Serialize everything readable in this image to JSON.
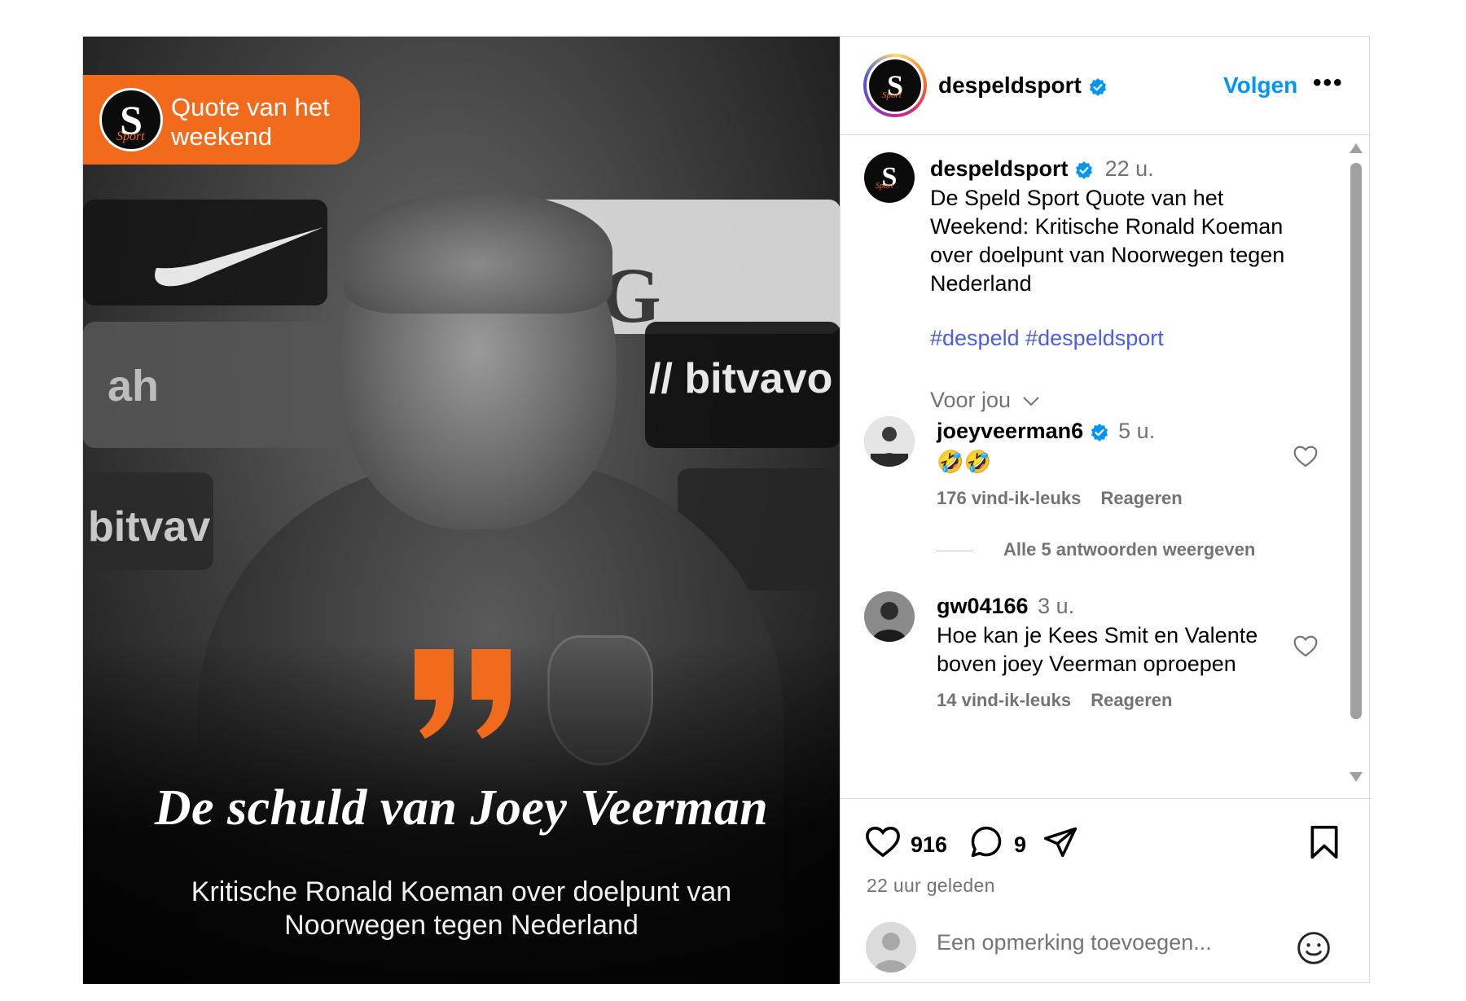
{
  "media": {
    "badge_text_line1": "Quote van het",
    "badge_text_line2": "weekend",
    "headline": "De schuld van Joey Veerman",
    "subline": "Kritische Ronald Koeman over doelpunt van Noorwegen tegen Nederland",
    "sponsor_bitvavo": "bitvavo",
    "sponsor_bitvavo_partial": "bitvav",
    "sponsor_g": "G",
    "sponsor_ah": "ah",
    "logo_letter": "S",
    "logo_script": "Sport"
  },
  "header": {
    "username": "despeldsport",
    "follow_label": "Volgen",
    "more_label": "•••"
  },
  "caption": {
    "username": "despeldsport",
    "time": "22 u.",
    "text": "De Speld Sport Quote van het Weekend: Kritische Ronald Koeman over doelpunt van Noorwegen tegen Nederland",
    "hashtag1": "#despeld",
    "hashtag2": "#despeldsport",
    "voor_jou": "Voor jou"
  },
  "comments": [
    {
      "username": "joeyveerman6",
      "time": "5 u.",
      "text": "🤣🤣",
      "likes": "176 vind-ik-leuks",
      "reply": "Reageren"
    },
    {
      "username": "gw04166",
      "time": "3 u.",
      "text": "Hoe kan je Kees Smit en Valente boven joey Veerman oproepen",
      "likes": "14 vind-ik-leuks",
      "reply": "Reageren"
    }
  ],
  "replies_toggle": "Alle 5 antwoorden weergeven",
  "actions": {
    "like_count": "916",
    "comment_count": "9",
    "posted": "22 uur geleden"
  },
  "add_comment": {
    "placeholder": "Een opmerking toevoegen..."
  },
  "colors": {
    "accent_orange": "#f26b1d",
    "link_blue": "#0095f6",
    "hashtag_blue": "#4a5fe0",
    "verified_blue": "#0095f6",
    "muted_text": "#737373"
  }
}
